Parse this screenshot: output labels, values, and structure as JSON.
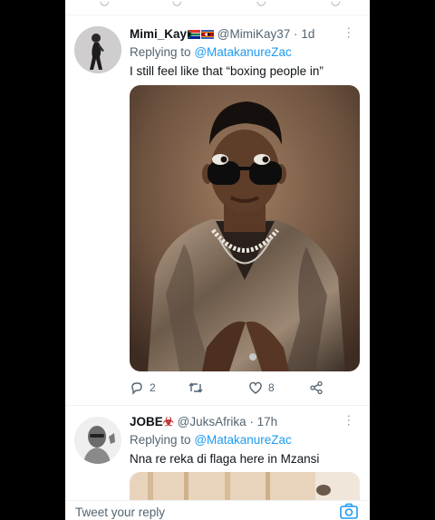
{
  "tweets": [
    {
      "name": "Mimi_Kay",
      "handle": "@MimiKay37",
      "time": "1d",
      "separator": "·",
      "reply_prefix": "Replying to",
      "reply_to": "@MatakanureZac",
      "text": "I still feel like that “boxing people in”",
      "reply_count": "2",
      "like_count": "8"
    },
    {
      "name": "JOBE",
      "name_suffix": "☣",
      "handle": "@JuksAfrika",
      "time": "17h",
      "separator": "·",
      "reply_prefix": "Replying to",
      "reply_to": "@MatakanureZac",
      "text": "Nna re reka di flaga here in Mzansi"
    }
  ],
  "compose": {
    "placeholder": "Tweet your reply"
  },
  "colors": {
    "accent": "#1d9bf0",
    "muted": "#536471",
    "text": "#0f1419",
    "background": "#000000"
  }
}
